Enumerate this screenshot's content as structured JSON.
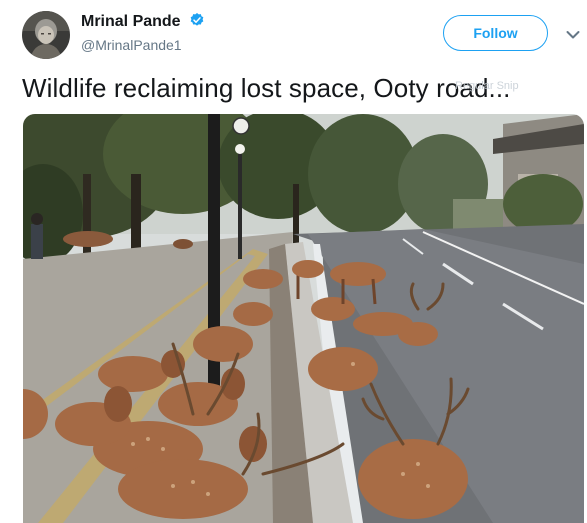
{
  "tweet": {
    "display_name": "Mrinal Pande",
    "handle": "@MrinalPande1",
    "text": "Wildlife reclaiming lost space, Ooty road...",
    "follow_label": "Follow",
    "watermark": "Regular Snip"
  },
  "icons": {
    "verified": "verified-badge-icon",
    "caret": "chevron-down-icon"
  },
  "colors": {
    "accent": "#1da1f2",
    "text_primary": "#14171a",
    "text_secondary": "#657786"
  }
}
